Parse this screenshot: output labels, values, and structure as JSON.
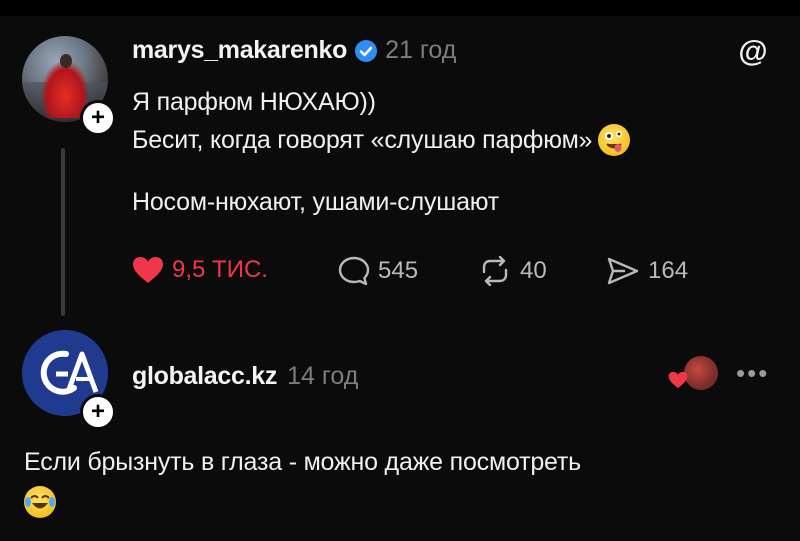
{
  "post1": {
    "username": "marys_makarenko",
    "verified": true,
    "time": "21 год",
    "line1": "Я парфюм НЮХАЮ))",
    "line2": "Бесит, когда говорят «слушаю парфюм»",
    "line3": "Носом-нюхают, ушами-слушают",
    "likes": "9,5 ТИС.",
    "comments": "545",
    "reposts": "40",
    "shares": "164",
    "emoji": "zany-face"
  },
  "post2": {
    "username": "globalacc.kz",
    "time": "14 год",
    "text": "Если брызнуть в глаза - можно даже посмотреть",
    "emoji": "tears-of-joy-face"
  },
  "colors": {
    "background": "#0b0b0b",
    "like": "#f2364a",
    "verified": "#2f8df5",
    "muted": "#7d7d7d"
  },
  "icons": {
    "threads": "threads-logo-icon",
    "more": "more-options-icon",
    "add": "plus-icon"
  }
}
